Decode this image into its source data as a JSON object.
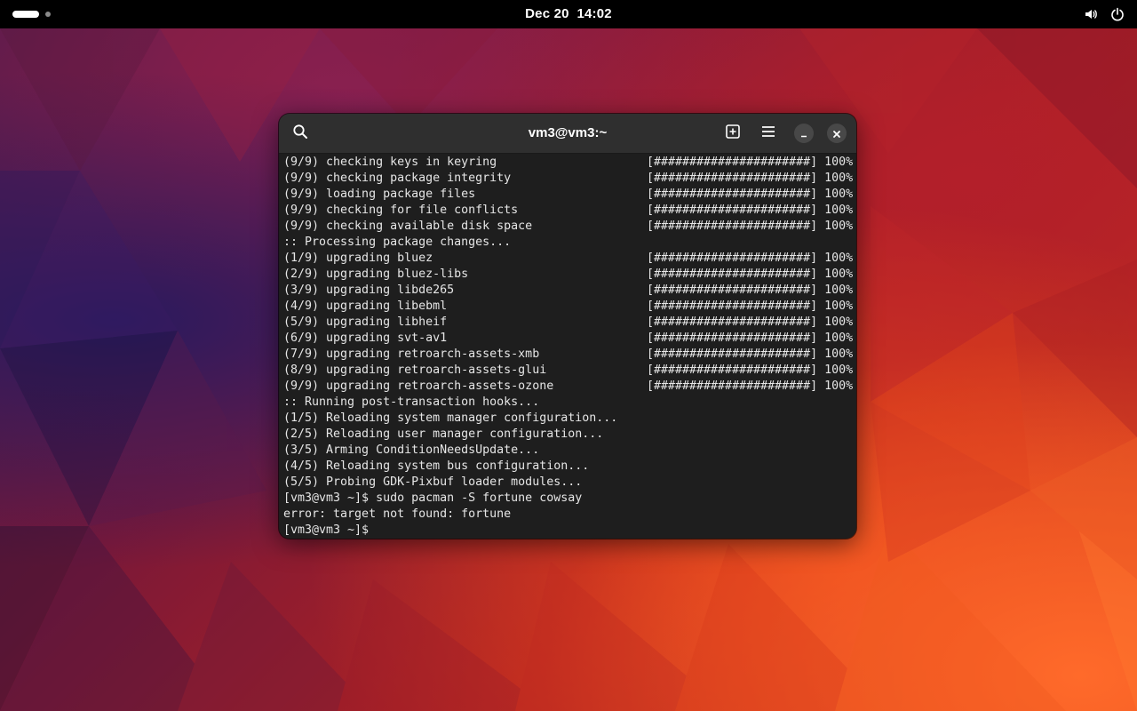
{
  "topbar": {
    "clock_date": "Dec 20",
    "clock_time": "14:02"
  },
  "icons": {
    "activities": "activities-indicator",
    "volume": "speaker-volume-icon",
    "power": "power-icon",
    "search": "search-icon",
    "new_tab": "new-tab-icon",
    "menu": "hamburger-menu-icon",
    "minimize": "minimize-icon",
    "close": "close-icon"
  },
  "terminal": {
    "title": "vm3@vm3:~",
    "lines": [
      {
        "left": "(9/9) checking keys in keyring",
        "right": "[######################] 100%"
      },
      {
        "left": "(9/9) checking package integrity",
        "right": "[######################] 100%"
      },
      {
        "left": "(9/9) loading package files",
        "right": "[######################] 100%"
      },
      {
        "left": "(9/9) checking for file conflicts",
        "right": "[######################] 100%"
      },
      {
        "left": "(9/9) checking available disk space",
        "right": "[######################] 100%"
      },
      {
        "left": ":: Processing package changes...",
        "right": ""
      },
      {
        "left": "(1/9) upgrading bluez",
        "right": "[######################] 100%"
      },
      {
        "left": "(2/9) upgrading bluez-libs",
        "right": "[######################] 100%"
      },
      {
        "left": "(3/9) upgrading libde265",
        "right": "[######################] 100%"
      },
      {
        "left": "(4/9) upgrading libebml",
        "right": "[######################] 100%"
      },
      {
        "left": "(5/9) upgrading libheif",
        "right": "[######################] 100%"
      },
      {
        "left": "(6/9) upgrading svt-av1",
        "right": "[######################] 100%"
      },
      {
        "left": "(7/9) upgrading retroarch-assets-xmb",
        "right": "[######################] 100%"
      },
      {
        "left": "(8/9) upgrading retroarch-assets-glui",
        "right": "[######################] 100%"
      },
      {
        "left": "(9/9) upgrading retroarch-assets-ozone",
        "right": "[######################] 100%"
      },
      {
        "left": ":: Running post-transaction hooks...",
        "right": ""
      },
      {
        "left": "(1/5) Reloading system manager configuration...",
        "right": ""
      },
      {
        "left": "(2/5) Reloading user manager configuration...",
        "right": ""
      },
      {
        "left": "(3/5) Arming ConditionNeedsUpdate...",
        "right": ""
      },
      {
        "left": "(4/5) Reloading system bus configuration...",
        "right": ""
      },
      {
        "left": "(5/5) Probing GDK-Pixbuf loader modules...",
        "right": ""
      },
      {
        "left": "[vm3@vm3 ~]$ sudo pacman -S fortune cowsay",
        "right": ""
      },
      {
        "left": "error: target not found: fortune",
        "right": ""
      },
      {
        "left": "[vm3@vm3 ~]$ ",
        "right": ""
      }
    ]
  },
  "colors": {
    "topbar_bg": "#000000",
    "terminal_bg": "#1e1e1e",
    "headerbar_bg": "#2f2f2f",
    "terminal_text": "#e6e6e6"
  }
}
